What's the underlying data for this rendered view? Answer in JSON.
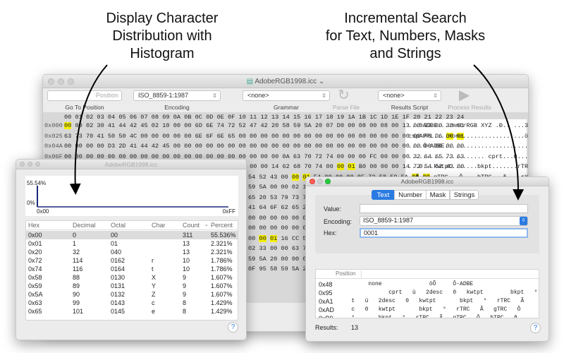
{
  "headlines": {
    "left": [
      "Display Character",
      "Distribution with",
      "Histogram"
    ],
    "right": [
      "Incremental Search",
      "for Text, Numbers, Masks",
      "and Strings"
    ]
  },
  "main_window": {
    "title": "AdobeRGB1998.icc",
    "toolbar": {
      "goto_placeholder": "Position",
      "goto_label": "Go To Position",
      "encoding_value": "ISO_8859-1:1987",
      "encoding_label": "Encoding",
      "grammar_value": "<none>",
      "grammar_label": "Grammar",
      "parse_label": "Parse File",
      "script_value": "<none>",
      "script_label": "Results Script",
      "process_label": "Process Results"
    },
    "column_header": "00 01 02 03 04 05 06 07 08 09 0A 0B 0C 0D 0E 0F 10 11 12 13 14 15 16 17 18 19 1A 1B 1C 1D 1E 1F 20 21 22 23 24",
    "rows": [
      {
        "offset": "0x000",
        "bytes": "00 00 02 30 41 44 42 45 02 10 00 00 6D 6E 74 72 52 47 42 20 58 59 5A 20 07 D0 00 08 00 08 00 13 00 33 00 38 61",
        "ascii": "...0ADBE....mntrRGB XYZ .Ð.. ...3.;a"
      },
      {
        "offset": "0x025",
        "bytes": "63 73 70 41 50 50 4C 00 00 00 00 00 6E 6F 6E 65 00 00 00 00 00 00 00 00 00 00 00 00 00 00 00 00 00 F6 D6 00 01",
        "ascii": "cspAPPL....none.................öÖ.."
      },
      {
        "offset": "0x04A",
        "bytes": "00 00 00 00 D3 2D 41 44 42 45 00 00 00 00 00 00 00 00 00 00 00 00 00 00 00 00 00 00 00 00 00 00 00 00 00 00 00",
        "ascii": "....Ó-ADBE..........................."
      },
      {
        "offset": "0x06F",
        "bytes": "00 00 00 00 00 00 00 00 00 00 00 00 00 00 00 00 00 00 00 00 0A 63 70 72 74 00 00 00 FC 00 00 00 32 64 65 73 63",
        "ascii": "..................... cprt...ü...2desc"
      },
      {
        "offset": "0x094",
        "bytes": "00 00 01 30 00 00 00 68 77 74 70 74 00 00 01 9C 00 00 00 14 62 68 70 74 00 00 01 B0 00 00 00 14 72 54 52 43 00",
        "ascii": "...0...kwtpt.......bkpt.......rTRC."
      }
    ],
    "partial_rows": [
      {
        "bytes": "54 52 43 00 00 01 E4 00 00 00 0E 72 58 59 5A 00 00",
        "ascii": "..Ã....gTRC...Ô....bTRC...ð....rXYZ.."
      },
      {
        "bytes": "59 5A 00 00 02 1C 00 00 00 14 74 65 78 74 00 00 00",
        "ascii": ".ô....gXYZ........bXYZ... ....text..."
      },
      {
        "bytes": "65 20 53 79 73 74"
      },
      {
        "bytes": "41 64 6F 62 65 20"
      },
      {
        "bytes": "00 00 00 00 00 00"
      },
      {
        "bytes": "00 00 00 00 00 00"
      },
      {
        "bytes": "00 00 01 16 CC 58"
      },
      {
        "bytes": "02 33 00 00 63 75"
      },
      {
        "bytes": "59 5A 20 00 00 00"
      },
      {
        "bytes": "0F 95 58 59 5A 20"
      }
    ],
    "highlight_color": "#f5f000"
  },
  "histogram_window": {
    "title": "AdobeRGB1998.icc",
    "chart": {
      "y_max_label": "55.54%",
      "y_min_label": "0%",
      "x_min_label": "0x00",
      "x_max_label": "0xFF",
      "line_color": "#1a2a7a"
    },
    "columns": [
      "Hex",
      "Decimal",
      "Octal",
      "Char",
      "Count",
      "Percent"
    ],
    "rows": [
      [
        "0x00",
        "0",
        "00",
        "",
        "311",
        "55.536%"
      ],
      [
        "0x01",
        "1",
        "01",
        "",
        "13",
        "2.321%"
      ],
      [
        "0x20",
        "32",
        "040",
        "",
        "13",
        "2.321%"
      ],
      [
        "0x72",
        "114",
        "0162",
        "r",
        "10",
        "1.786%"
      ],
      [
        "0x74",
        "116",
        "0164",
        "t",
        "10",
        "1.786%"
      ],
      [
        "0x58",
        "88",
        "0130",
        "X",
        "9",
        "1.607%"
      ],
      [
        "0x59",
        "89",
        "0131",
        "Y",
        "9",
        "1.607%"
      ],
      [
        "0x5A",
        "90",
        "0132",
        "Z",
        "9",
        "1.607%"
      ],
      [
        "0x63",
        "99",
        "0143",
        "c",
        "8",
        "1.429%"
      ],
      [
        "0x65",
        "101",
        "0145",
        "e",
        "8",
        "1.429%"
      ]
    ],
    "help": "?"
  },
  "search_window": {
    "title": "AdobeRGB1998.icc",
    "tabs": [
      "Text",
      "Number",
      "Mask",
      "Strings"
    ],
    "active_tab": "Text",
    "value_label": "Value:",
    "value": "",
    "encoding_label": "Encoding:",
    "encoding_value": "ISO_8859-1:1987",
    "hex_label": "Hex:",
    "hex_value": "0001",
    "results_header": "Position",
    "results": [
      {
        "pos": "0x48",
        "text": "        none              öÕ     Ô-ADBE"
      },
      {
        "pos": "0x95",
        "text": "              cprt   ü   2desc   0   kwtpt        bkpt   °"
      },
      {
        "pos": "0xA1",
        "text": "   t   ü   2desc   0   kwtpt       bkpt   °   rTRC   Ã"
      },
      {
        "pos": "0xAD",
        "text": "   c   0   kwtpt       bkpt   °   rTRC   Ã   gTRC   Ô"
      },
      {
        "pos": "0xB9",
        "text": "   °       bkpt   °   rTRC   Ã   gTRC   Ô   bTRC   ð"
      }
    ],
    "results_label": "Results:",
    "results_count": "13",
    "help": "?",
    "accent": "#2a7ae2"
  }
}
